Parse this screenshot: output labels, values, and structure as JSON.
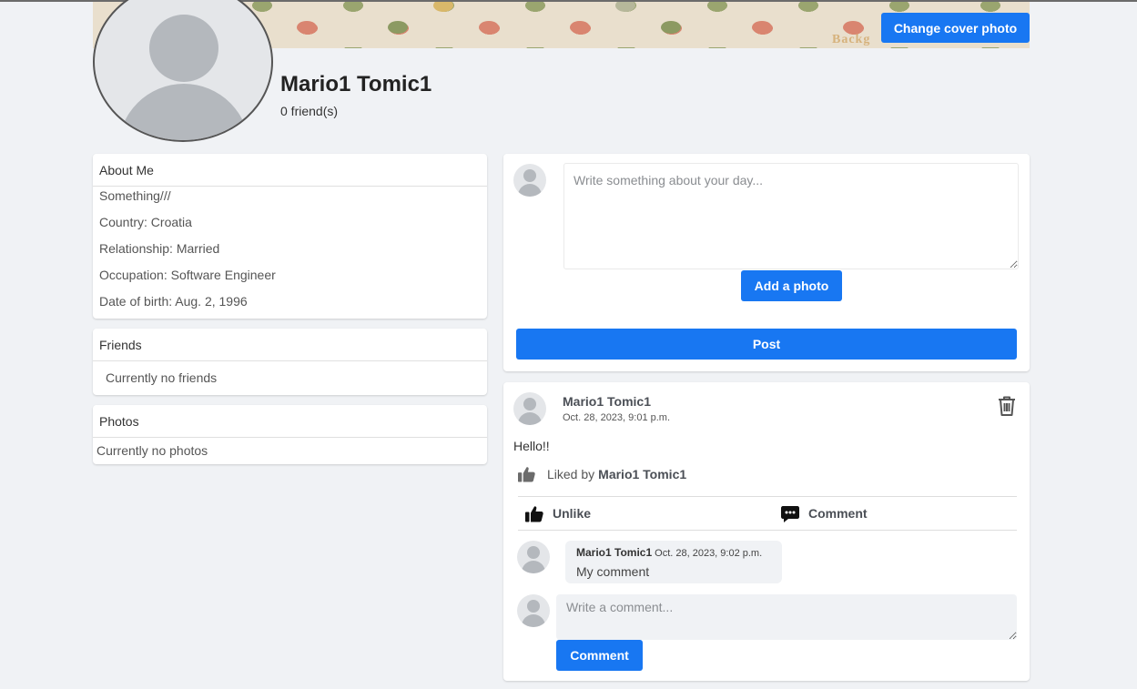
{
  "cover": {
    "change_button": "Change cover photo",
    "watermark": "Backg"
  },
  "profile": {
    "name": "Mario1 Tomic1",
    "friend_count": "0 friend(s)"
  },
  "about": {
    "title": "About Me",
    "lines": [
      "Something///",
      "Country: Croatia",
      "Relationship: Married",
      "Occupation: Software Engineer",
      "Date of birth: Aug. 2, 1996"
    ]
  },
  "friends": {
    "title": "Friends",
    "empty_text": "Currently no friends"
  },
  "photos": {
    "title": "Photos",
    "empty_text": "Currently no photos"
  },
  "composer": {
    "placeholder": "Write something about your day...",
    "add_photo_label": "Add a photo",
    "post_label": "Post"
  },
  "post": {
    "author": "Mario1 Tomic1",
    "date": "Oct. 28, 2023, 9:01 p.m.",
    "text": "Hello!!",
    "liked_by_prefix": "Liked by",
    "liked_by_name": "Mario1 Tomic1",
    "unlike_label": "Unlike",
    "comment_label": "Comment",
    "comment": {
      "author": "Mario1 Tomic1",
      "date": "Oct. 28, 2023, 9:02 p.m.",
      "text": "My comment"
    },
    "comment_placeholder": "Write a comment...",
    "comment_submit_label": "Comment"
  },
  "icons": {
    "trash": "trash-icon",
    "like": "thumbs-up-icon",
    "comment": "comment-bubble-icon",
    "avatar": "user-avatar-icon"
  },
  "colors": {
    "accent": "#1877f2",
    "background": "#f0f2f5"
  }
}
